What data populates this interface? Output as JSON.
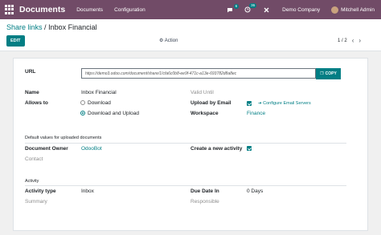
{
  "navbar": {
    "app_name": "Documents",
    "menu": [
      "Documents",
      "Configuration"
    ],
    "chat_count": "6",
    "activity_count": "36",
    "company": "Demo Company",
    "user": "Mitchell Admin"
  },
  "control_panel": {
    "breadcrumb_parent": "Share links",
    "breadcrumb_sep": "/",
    "breadcrumb_current": "Inbox Financial",
    "edit_label": "EDIT",
    "action_label": "Action",
    "pager": "1 / 2"
  },
  "form": {
    "url_label": "URL",
    "url_value": "https://demo3.odoo.com/document/share/1/cfa6c0b8-ee9f-471c-a13e-693782d8a8ec",
    "copy_label": "COPY",
    "name_label": "Name",
    "name_value": "Inbox Financial",
    "valid_until_placeholder": "Valid Until",
    "allows_to_label": "Allows to",
    "allows_options": [
      "Download",
      "Download and Upload"
    ],
    "allows_selected": "Download and Upload",
    "upload_by_email_label": "Upload by Email",
    "upload_by_email_checked": true,
    "configure_email_label": "Configure Email Servers",
    "workspace_label": "Workspace",
    "workspace_value": "Finance",
    "defaults_title": "Default values for uploaded documents",
    "document_owner_label": "Document Owner",
    "document_owner_value": "OdooBot",
    "contact_placeholder": "Contact",
    "create_activity_label": "Create a new activity",
    "create_activity_checked": true,
    "activity_title": "Activity",
    "activity_type_label": "Activity type",
    "activity_type_value": "Inbox",
    "summary_placeholder": "Summary",
    "due_date_label": "Due Date In",
    "due_date_value": "0 Days",
    "responsible_placeholder": "Responsible"
  },
  "colors": {
    "navbar": "#714b67",
    "accent": "#017e84"
  }
}
